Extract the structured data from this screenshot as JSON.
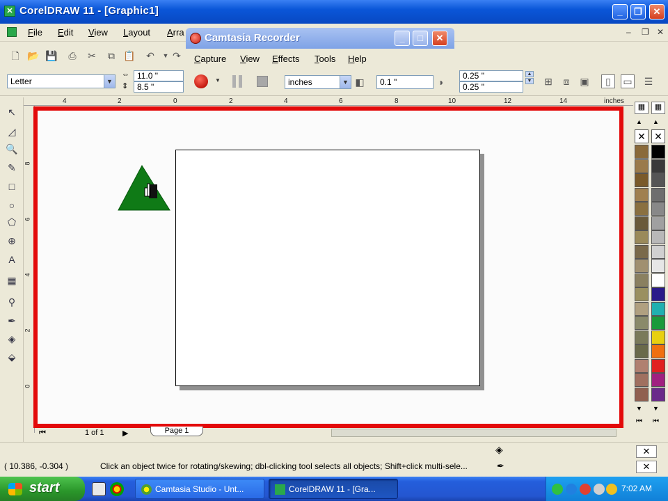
{
  "window": {
    "title": "CorelDRAW 11 - [Graphic1]",
    "app_icon": "coreldraw-icon",
    "controls": [
      "minimize-icon",
      "restore-icon",
      "close-icon"
    ]
  },
  "menu": {
    "items": [
      "File",
      "Edit",
      "View",
      "Layout",
      "Arra"
    ]
  },
  "property_bar": {
    "paper_size": "Letter",
    "width_value": "11.0 \"",
    "height_value": "8.5 \"",
    "nudge_value": "0.25 \"",
    "nudge_value2": "0.25 \""
  },
  "camtasia": {
    "title": "Camtasia Recorder",
    "menu": [
      "Capture",
      "View",
      "Effects",
      "Tools",
      "Help"
    ],
    "units_value": "inches",
    "nudge_value": "0.1 \""
  },
  "ruler": {
    "unit_label": "inches",
    "h_ticks": [
      "4",
      "2",
      "0",
      "2",
      "4",
      "6",
      "8",
      "10",
      "12",
      "14"
    ],
    "v_ticks": [
      "8",
      "6",
      "4",
      "2",
      "0"
    ]
  },
  "doc_nav": {
    "page_count": "1 of 1",
    "page_tab": "Page 1"
  },
  "palette": {
    "colors": [
      "#000000",
      "#3a3a3a",
      "#555555",
      "#6e6e6e",
      "#888888",
      "#a0a0a0",
      "#b8b8b8",
      "#d0d0d0",
      "#e6e6e6",
      "#ffffff",
      "#2a1a8a",
      "#20b0b0",
      "#1a9a3a",
      "#e8d010",
      "#f07010",
      "#e02020",
      "#a02080",
      "#6a2a8a"
    ],
    "earth_colors": [
      "#8a6a3a",
      "#9a7a4a",
      "#7a5a2a",
      "#a08050",
      "#8a7040",
      "#6a5a3a",
      "#9a8a5a",
      "#7a6a4a",
      "#a09070",
      "#8a8060",
      "#9a9060",
      "#b0a080",
      "#8a8a6a",
      "#7a7a5a",
      "#6a6a4a",
      "#b08070",
      "#a07060",
      "#906050"
    ]
  },
  "status": {
    "coordinates": "( 10.386, -0.304 )",
    "message": "Click an object twice for rotating/skewing; dbl-clicking tool selects all objects; Shift+click multi-sele..."
  },
  "taskbar": {
    "start_label": "start",
    "tasks": [
      "Camtasia Studio - Unt...",
      "CorelDRAW 11 - [Gra..."
    ],
    "clock": "7:02 AM"
  },
  "colors": {
    "highlight_border": "#e30a0a",
    "triangle_fill": "#0f7a16",
    "xp_blue": "#245edc"
  }
}
